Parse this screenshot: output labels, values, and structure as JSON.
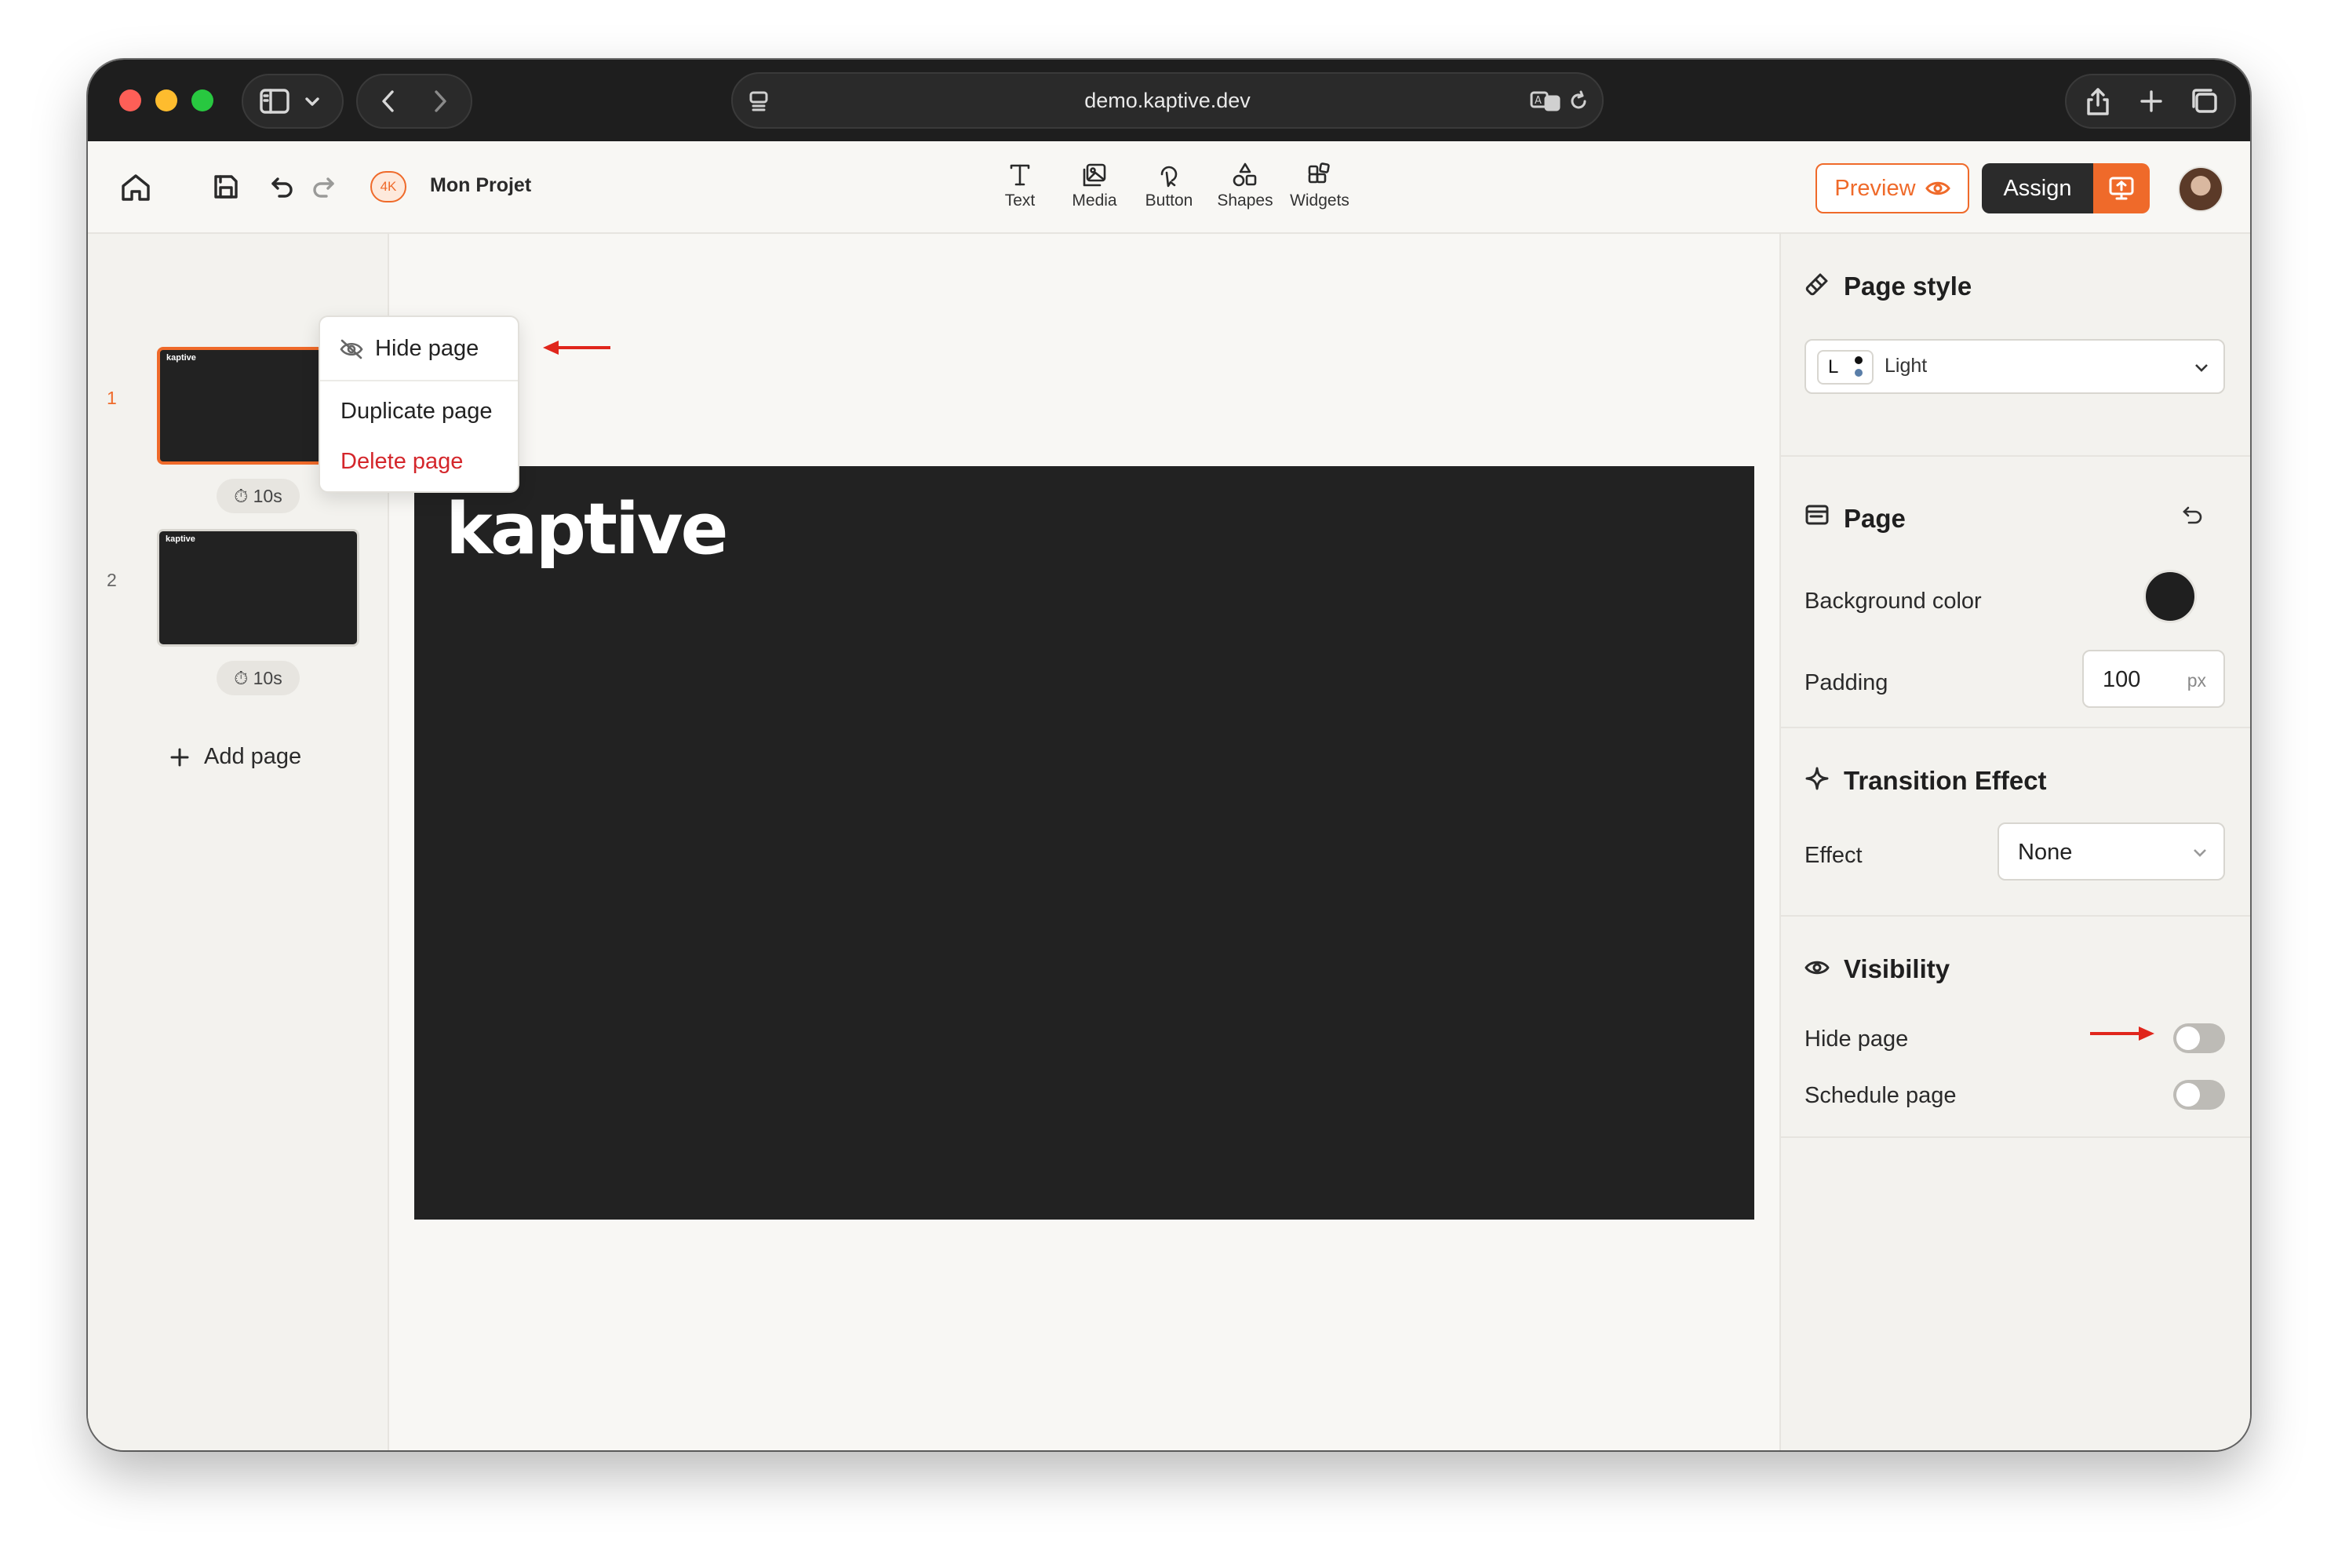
{
  "browser": {
    "url": "demo.kaptive.dev"
  },
  "toolbar": {
    "badge": "4K",
    "project_title": "Mon Projet",
    "tools": [
      {
        "label": "Text",
        "icon": "text-icon"
      },
      {
        "label": "Media",
        "icon": "media-icon"
      },
      {
        "label": "Button",
        "icon": "button-icon"
      },
      {
        "label": "Shapes",
        "icon": "shapes-icon"
      },
      {
        "label": "Widgets",
        "icon": "widgets-icon"
      }
    ],
    "preview_label": "Preview",
    "assign_label": "Assign"
  },
  "sidebar": {
    "pages": [
      {
        "number": "1",
        "duration": "10s",
        "thumb_logo": "kaptive"
      },
      {
        "number": "2",
        "duration": "10s",
        "thumb_logo": "kaptive"
      }
    ],
    "add_page_label": "Add page"
  },
  "context_menu": {
    "hide": "Hide page",
    "duplicate": "Duplicate page",
    "delete": "Delete page"
  },
  "canvas": {
    "logo_text": "kaptive",
    "background": "#222222"
  },
  "panel": {
    "page_style": {
      "title": "Page style",
      "select_badge": "L",
      "select_value": "Light"
    },
    "page": {
      "title": "Page",
      "bg_label": "Background color",
      "bg_color": "#1f1f1f",
      "padding_label": "Padding",
      "padding_value": "100",
      "padding_unit": "px"
    },
    "transition": {
      "title": "Transition Effect",
      "effect_label": "Effect",
      "effect_value": "None"
    },
    "visibility": {
      "title": "Visibility",
      "hide_label": "Hide page",
      "schedule_label": "Schedule page",
      "hide_on": false,
      "schedule_on": false
    }
  },
  "colors": {
    "accent": "#ef6a2a",
    "danger": "#d4262b",
    "annotation_arrow": "#e0261c"
  }
}
